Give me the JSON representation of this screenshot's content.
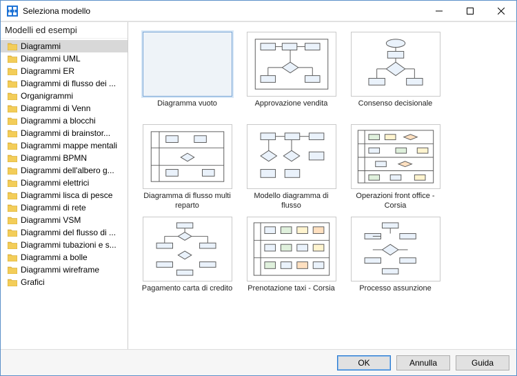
{
  "window": {
    "title": "Seleziona modello"
  },
  "sidebar": {
    "header": "Modelli ed esempi",
    "items": [
      {
        "label": "Diagrammi",
        "selected": true
      },
      {
        "label": "Diagrammi UML"
      },
      {
        "label": "Diagrammi ER"
      },
      {
        "label": "Diagrammi di flusso dei ..."
      },
      {
        "label": "Organigrammi"
      },
      {
        "label": "Diagrammi di Venn"
      },
      {
        "label": "Diagrammi a blocchi"
      },
      {
        "label": "Diagrammi di brainstor..."
      },
      {
        "label": "Diagrammi mappe mentali"
      },
      {
        "label": "Diagrammi BPMN"
      },
      {
        "label": "Diagrammi dell'albero g..."
      },
      {
        "label": "Diagrammi elettrici"
      },
      {
        "label": "Diagrammi lisca di pesce"
      },
      {
        "label": "Diagrammi di rete"
      },
      {
        "label": "Diagrammi VSM"
      },
      {
        "label": "Diagrammi del flusso di ..."
      },
      {
        "label": "Diagrammi tubazioni e s..."
      },
      {
        "label": "Diagrammi a bolle"
      },
      {
        "label": "Diagrammi wireframe"
      },
      {
        "label": "Grafici"
      }
    ]
  },
  "templates": [
    {
      "label": "Diagramma vuoto",
      "kind": "blank",
      "selected": true
    },
    {
      "label": "Approvazione vendita",
      "kind": "flow1"
    },
    {
      "label": "Consenso decisionale",
      "kind": "flow2"
    },
    {
      "label": "Diagramma di flusso multi reparto",
      "kind": "swim1"
    },
    {
      "label": "Modello diagramma di flusso",
      "kind": "flow3"
    },
    {
      "label": "Operazioni front office - Corsia",
      "kind": "swim2"
    },
    {
      "label": "Pagamento carta di credito",
      "kind": "flow4"
    },
    {
      "label": "Prenotazione taxi - Corsia",
      "kind": "swim3"
    },
    {
      "label": "Processo assunzione",
      "kind": "flow5"
    }
  ],
  "buttons": {
    "ok": "OK",
    "cancel": "Annulla",
    "help": "Guida"
  }
}
